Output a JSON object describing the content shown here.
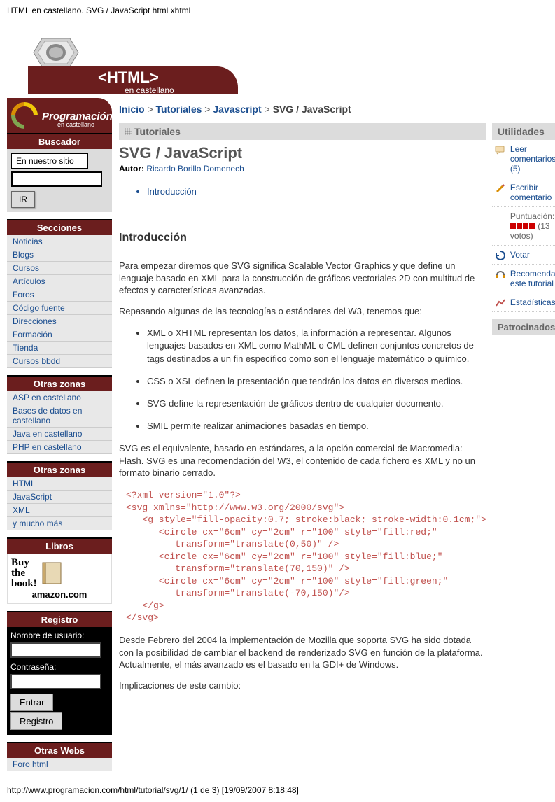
{
  "page_header": "HTML en castellano. SVG / JavaScript html xhtml",
  "banner": {
    "title": "<HTML>",
    "subtitle": "en castellano"
  },
  "prog_badge": {
    "title": "Programación",
    "sub": "en castellano"
  },
  "search": {
    "header": "Buscador",
    "label": "En nuestro sitio",
    "button": "IR"
  },
  "sections": {
    "secciones_header": "Secciones",
    "secciones": [
      "Noticias",
      "Blogs",
      "Cursos",
      "Artículos",
      "Foros",
      "Código fuente",
      "Direcciones",
      "Formación",
      "Tienda",
      "Cursos bbdd"
    ],
    "zonas1_header": "Otras zonas",
    "zonas1": [
      "ASP en castellano",
      "Bases de datos en castellano",
      "Java en castellano",
      "PHP en castellano"
    ],
    "zonas2_header": "Otras zonas",
    "zonas2": [
      "HTML",
      "JavaScript",
      "XML",
      "y mucho más"
    ],
    "libros_header": "Libros",
    "amazon": {
      "l1": "Buy",
      "l2": "the",
      "l3": "book!",
      "brand": "amazon.com"
    },
    "registro_header": "Registro",
    "reg_user_label": "Nombre de usuario:",
    "reg_pass_label": "Contraseña:",
    "reg_enter": "Entrar",
    "reg_signup": "Registro",
    "otras_webs_header": "Otras Webs",
    "otras_webs": [
      "Foro html"
    ]
  },
  "breadcrumb": {
    "items": [
      "Inicio",
      "Tutoriales",
      "Javascript"
    ],
    "current": "SVG / JavaScript",
    "sep": ">"
  },
  "article": {
    "col_header": "Tutoriales",
    "title": "SVG / JavaScript",
    "author_label": "Autor:",
    "author": "Ricardo Borillo Domenech",
    "toc": [
      "Introducción"
    ],
    "h2": "Introducción",
    "p1": "Para empezar diremos que SVG significa Scalable Vector Graphics y que define un lenguaje basado en XML para la construcción de gráficos vectoriales 2D con multitud de efectos y características avanzadas.",
    "p2": "Repasando algunas de las tecnologías o estándares del W3, tenemos que:",
    "bullets": [
      "XML o XHTML representan los datos, la información a representar. Algunos lenguajes basados en XML como MathML o CML definen conjuntos concretos de tags destinados a un fin específico como son el lenguaje matemático o químico.",
      "CSS o XSL definen la presentación que tendrán los datos en diversos medios.",
      "SVG define la representación de gráficos dentro de cualquier documento.",
      "SMIL permite realizar animaciones basadas en tiempo."
    ],
    "p3": "SVG es el equivalente, basado en estándares, a la opción comercial de Macromedia: Flash. SVG es una recomendación del W3, el contenido de cada fichero es XML y no un formato binario cerrado.",
    "code": "<?xml version=\"1.0\"?>\n<svg xmlns=\"http://www.w3.org/2000/svg\">\n   <g style=\"fill-opacity:0.7; stroke:black; stroke-width:0.1cm;\">\n      <circle cx=\"6cm\" cy=\"2cm\" r=\"100\" style=\"fill:red;\"\n         transform=\"translate(0,50)\" />\n      <circle cx=\"6cm\" cy=\"2cm\" r=\"100\" style=\"fill:blue;\"\n         transform=\"translate(70,150)\" />\n      <circle cx=\"6cm\" cy=\"2cm\" r=\"100\" style=\"fill:green;\"\n         transform=\"translate(-70,150)\"/>\n   </g>\n</svg>",
    "p4": "Desde Febrero del 2004 la implementación de Mozilla que soporta SVG ha sido dotada con la posibilidad de cambiar el backend de renderizado SVG en función de la plataforma. Actualmente, el más avanzado es el basado en la GDI+ de Windows.",
    "p5": "Implicaciones de este cambio:"
  },
  "utilities": {
    "header": "Utilidades",
    "read_comments": "Leer comentarios (5)",
    "write_comment": "Escribir comentario",
    "rating_label": "Puntuación:",
    "rating_votes": "(13 votos)",
    "vote": "Votar",
    "recommend": "Recomendar este tutorial",
    "stats": "Estadísticas",
    "patroc": "Patrocinados"
  },
  "footer_url": "http://www.programacion.com/html/tutorial/svg/1/ (1 de 3) [19/09/2007 8:18:48]"
}
